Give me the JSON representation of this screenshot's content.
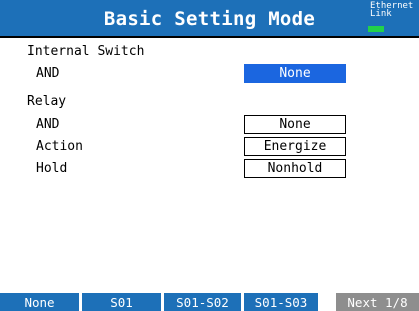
{
  "header": {
    "title": "Basic Setting Mode",
    "ethernet_line1": "Ethernet",
    "ethernet_line2": "Link",
    "accent_color": "#1d70b8",
    "link_status_color": "#22d14a"
  },
  "internal_switch": {
    "heading": "Internal Switch",
    "and_label": "AND",
    "and_value": "None"
  },
  "relay": {
    "heading": "Relay",
    "and_label": "AND",
    "and_value": "None",
    "action_label": "Action",
    "action_value": "Energize",
    "hold_label": "Hold",
    "hold_value": "Nonhold"
  },
  "softkeys": {
    "key1": "None",
    "key2": "S01",
    "key3": "S01-S02",
    "key4": "S01-S03",
    "key5": "Next 1/8"
  }
}
